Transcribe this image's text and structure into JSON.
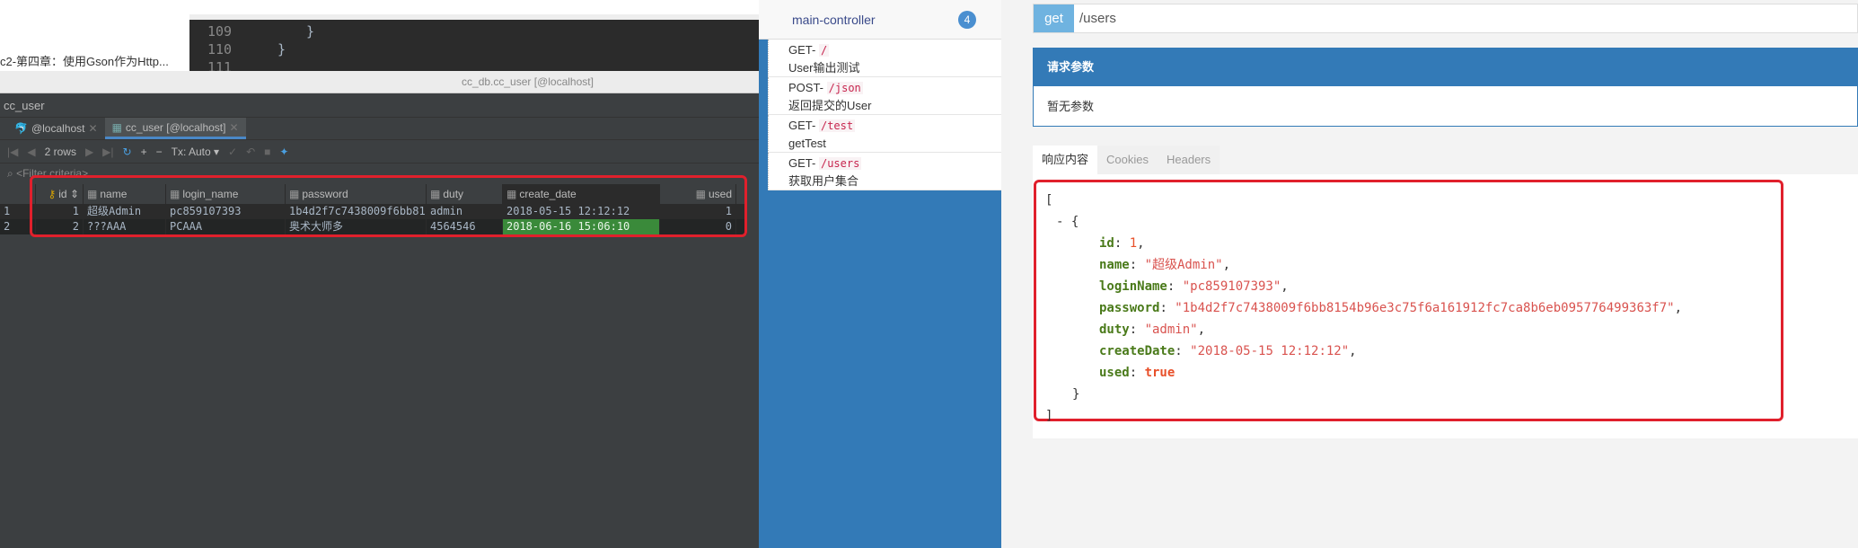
{
  "browser": {
    "link_text": "c2-第四章：使用Gson作为Http..."
  },
  "editor": {
    "lines": [
      {
        "num": "109",
        "code": "}"
      },
      {
        "num": "110",
        "code": "}"
      },
      {
        "num": "111",
        "code": ""
      }
    ]
  },
  "db": {
    "window_title": "cc_db.cc_user [@localhost]",
    "breadcrumb": "cc_user",
    "tabs": [
      {
        "label": "@localhost"
      },
      {
        "label": "cc_user [@localhost]"
      }
    ],
    "toolbar": {
      "rows": "2 rows",
      "tx": "Tx: Auto"
    },
    "filter_placeholder": "<Filter criteria>",
    "columns": [
      "id",
      "name",
      "login_name",
      "password",
      "duty",
      "create_date",
      "used"
    ],
    "rows": [
      {
        "num": "1",
        "id": "1",
        "name": "超级Admin",
        "login_name": "pc859107393",
        "password": "1b4d2f7c7438009f6bb81…",
        "duty": "admin",
        "create_date": "2018-05-15 12:12:12",
        "used": "1"
      },
      {
        "num": "2",
        "id": "2",
        "name": "???AAA",
        "login_name": "PCAAA",
        "password": "奥术大师多",
        "duty": "4564546",
        "create_date": "2018-06-16 15:06:10",
        "used": "0"
      }
    ]
  },
  "swagger": {
    "controller": "main-controller",
    "count": "4",
    "apis": [
      {
        "method": "GET-",
        "path": "/",
        "desc": "User输出测试"
      },
      {
        "method": "POST-",
        "path": "/json",
        "desc": "返回提交的User"
      },
      {
        "method": "GET-",
        "path": "/test",
        "desc": "getTest"
      },
      {
        "method": "GET-",
        "path": "/users",
        "desc": "获取用户集合"
      }
    ],
    "request": {
      "method": "get",
      "url": "/users"
    },
    "params_title": "请求参数",
    "params_empty": "暂无参数",
    "resp_tabs": [
      "响应内容",
      "Cookies",
      "Headers"
    ],
    "json": {
      "open": "[",
      "obj_open": "- {",
      "id_key": "id",
      "id_val": "1",
      "name_key": "name",
      "name_val": "\"超级Admin\"",
      "login_key": "loginName",
      "login_val": "\"pc859107393\"",
      "pw_key": "password",
      "pw_val": "\"1b4d2f7c7438009f6bb8154b96e3c75f6a161912fc7ca8b6eb095776499363f7\"",
      "duty_key": "duty",
      "duty_val": "\"admin\"",
      "date_key": "createDate",
      "date_val": "\"2018-05-15 12:12:12\"",
      "used_key": "used",
      "used_val": "true",
      "obj_close": "}",
      "close": "]"
    }
  }
}
